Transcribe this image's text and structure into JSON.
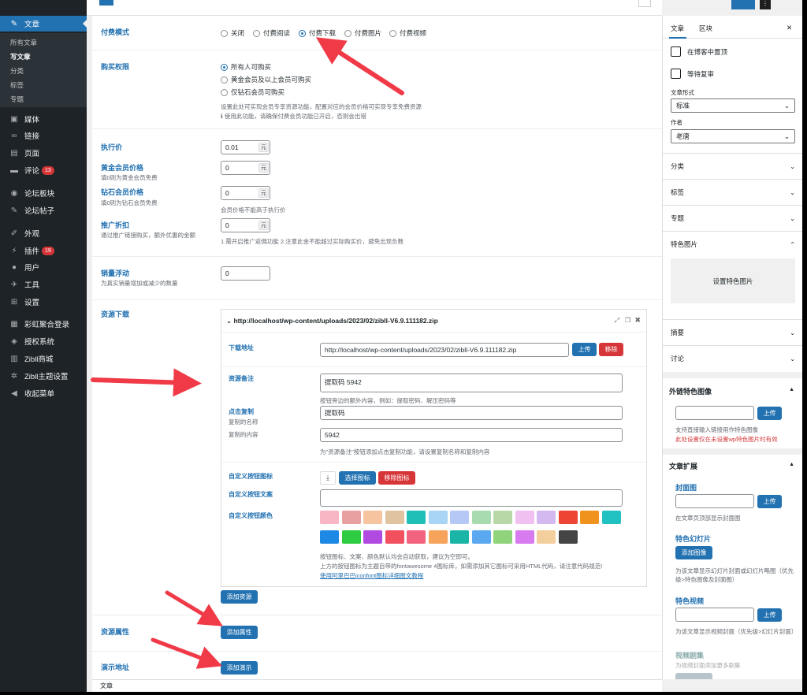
{
  "sidebar": {
    "posts": "文章",
    "all_posts": "所有文章",
    "write_post": "写文章",
    "categories": "分类",
    "tags": "标签",
    "topics": "专题",
    "media": "媒体",
    "links": "链接",
    "pages": "页面",
    "comments": "评论",
    "comments_count": "13",
    "forum_sections": "论坛板块",
    "forum_posts": "论坛帖子",
    "appearance": "外观",
    "plugins": "插件",
    "plugins_count": "19",
    "users": "用户",
    "tools": "工具",
    "settings": "设置",
    "rainbow_login": "彩虹聚合登录",
    "license": "授权系统",
    "zibll_shop": "Zibll商城",
    "zibll_theme": "Zibll主题设置",
    "collapse": "收起菜单"
  },
  "pay_mode": {
    "label": "付费模式",
    "options": [
      "关闭",
      "付费阅读",
      "付费下载",
      "付费图片",
      "付费视频"
    ],
    "selected": "付费下载"
  },
  "purchase": {
    "label": "购买权限",
    "options": [
      "所有人可购买",
      "黄金会员及以上会员可购买",
      "仅钻石会员可购买"
    ],
    "selected": "所有人可购买",
    "desc1": "设置此处可实现会员专享资源功能，配置对应的会员价格可实现专享免费资源",
    "desc2": "ℹ 使用此功能，请确保付费会员功能已开启，否则会出错"
  },
  "pricing": {
    "exec_price_label": "执行价",
    "exec_price": "0.01",
    "unit": "元",
    "gold_label": "黄金会员价格",
    "gold_desc": "填0则为黄金会员免费",
    "gold_price": "0",
    "diamond_label": "钻石会员价格",
    "diamond_desc": "填0则为钻石会员免费",
    "diamond_price": "0",
    "member_note": "会员价格不能高于执行价",
    "promo_label": "推广折扣",
    "promo_desc": "通过推广链接购买，额外优惠的金额",
    "promo_value": "0",
    "promo_note": "1.需开启推广返佣功能 2.注意此金不能超过实际购买价，避免出现负数"
  },
  "sales": {
    "label": "销量浮动",
    "desc": "为真实销量增加或减少的数量",
    "value": "0"
  },
  "resource": {
    "label": "资源下载",
    "title": "⌄ http://localhost/wp-content/uploads/2023/02/zibll-V6.9.111182.zip",
    "url_label": "下载地址",
    "url_value": "http://localhost/wp-content/uploads/2023/02/zibll-V6.9.111182.zip",
    "upload": "上传",
    "remove": "移除",
    "note_label": "资源备注",
    "note_value": "提取码 5942",
    "note_desc": "按钮旁边的额外内容，例如：提取密码、解压密码等",
    "copy_label": "点击复制",
    "copy_name_label": "复制的名称",
    "copy_name": "提取码",
    "copy_content_label": "复制的内容",
    "copy_content": "5942",
    "copy_desc": "为\"资源备注\"按钮添加点击复制功能，请设置复制名称和复制内容",
    "icon_label": "自定义按钮图标",
    "select_icon": "选择图标",
    "remove_icon": "移除图标",
    "text_label": "自定义按钮文案",
    "color_label": "自定义按钮颜色",
    "help1": "按钮图标、文案、颜色默认均会自动获取，建议为空即可。",
    "help2": "上方的按钮图标为主题自带的fontawesome 4图标库，如需添加其它图标可采用HTML代码，请注意代码规范!",
    "help_link": "使用阿里巴巴iconfont图标详细图文教程",
    "add_resource": "添加资源"
  },
  "attributes": {
    "label": "资源属性",
    "button": "添加属性"
  },
  "demo": {
    "label": "演示地址",
    "button": "添加演示"
  },
  "swatches1": [
    "#f8b5c3",
    "#e8a0a0",
    "#f6c49e",
    "#e0c4a0",
    "#1fbfb8",
    "#a8d4f5",
    "#b6c8f5",
    "#a8dcb0",
    "#b8d8a8",
    "#f0c0f0",
    "#d4b8f0",
    "#ee4433",
    "#f0921e",
    "#22c2c2"
  ],
  "swatches2": [
    "#1e88e5",
    "#2ecc40",
    "#b04ae0",
    "#f24f5f",
    "#f2637f",
    "#f6a35b",
    "#1bb5a8",
    "#5aa8f0",
    "#8fd47a",
    "#d87af0",
    "#f4cf9e",
    "#444444"
  ],
  "panel": {
    "tab_post": "文章",
    "tab_block": "区块",
    "close": "✕",
    "sticky": "在博客中置顶",
    "pending": "等待复审",
    "format_label": "文章形式",
    "format_value": "标准",
    "author_label": "作者",
    "author_value": "老唐",
    "categories": "分类",
    "tags": "标签",
    "topics": "专题",
    "featured": "特色图片",
    "set_featured": "设置特色图片",
    "excerpt": "摘要",
    "discussion": "讨论",
    "ext_img_title": "外链特色图像",
    "upload": "上传",
    "ext_img_desc": "支持直接输入链接用作特色图像",
    "ext_img_warn": "此处设置仅在未设置wp特色图片时有效",
    "ext_title": "文章扩展",
    "cover_label": "封面图",
    "cover_desc": "在文章页顶部显示封面图",
    "slides_label": "特色幻灯片",
    "add_image": "添加图像",
    "slides_desc": "为该文章显示幻灯片封面或幻灯片略图（优先级>特色图像及封面图）",
    "video_label": "特色视频",
    "video_desc": "为该文章显示视频封面（优先级>幻灯片封面）",
    "episodes_label": "视频剧集",
    "episodes_desc": "为视频封面添加更多剧集"
  },
  "status": "文章"
}
